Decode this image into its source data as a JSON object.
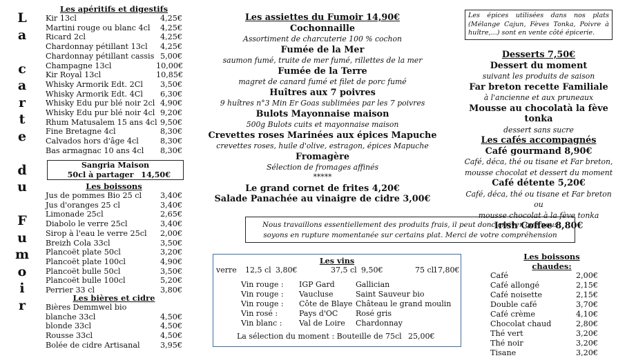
{
  "side_title": [
    "L",
    "a",
    "",
    "c",
    "a",
    "r",
    "t",
    "e",
    "",
    "d",
    "u",
    "",
    "F",
    "u",
    "m",
    "o",
    "i",
    "r"
  ],
  "aperitifs": {
    "title": "Les apéritifs et digestifs",
    "items": [
      {
        "name": "Kir 13cl",
        "price": "4,25€"
      },
      {
        "name": "Martini rouge ou blanc 4cl",
        "price": "4,25€"
      },
      {
        "name": "Ricard 2cl",
        "price": "4,25€"
      },
      {
        "name": "Chardonnay pétillant   13cl",
        "price": "4,25€"
      },
      {
        "name": "Chardonnay pétillant cassis",
        "price": "5,00€"
      },
      {
        "name": "Champagne 13cl",
        "price": "10,00€"
      },
      {
        "name": "Kir Royal 13cl",
        "price": "10,85€"
      },
      {
        "name": "Whisky Armorik Edt. 2Cl",
        "price": "3,50€"
      },
      {
        "name": "Whisky Armorik Edt. 4Cl",
        "price": "6,30€"
      },
      {
        "name": "Whisky Edu pur blé noir 2cl",
        "price": "4,90€"
      },
      {
        "name": "Whisky Edu pur blé noir 4cl",
        "price": "9,20€"
      },
      {
        "name": "Rhum Matusalem 15 ans 4cl",
        "price": "9,50€"
      },
      {
        "name": "Fine Bretagne 4cl",
        "price": "8,30€"
      },
      {
        "name": "Calvados hors d'âge 4cl",
        "price": "8,30€"
      },
      {
        "name": "Bas armagnac 10 ans 4cl",
        "price": "8,30€"
      }
    ]
  },
  "sangria": {
    "title": "Sangria Maison",
    "label": "50cl à partager",
    "price": "14,50€"
  },
  "boissons": {
    "title": "Les boissons",
    "items": [
      {
        "name": "Jus de pommes Bio 25 cl",
        "price": "3,40€"
      },
      {
        "name": "Jus d'oranges 25 cl",
        "price": "3,40€"
      },
      {
        "name": "Limonade 25cl",
        "price": "2,65€"
      },
      {
        "name": "Diabolo le verre 25cl",
        "price": "3,40€"
      },
      {
        "name": "Sirop à l'eau le verre 25cl",
        "price": "2,00€"
      },
      {
        "name": "Breizh Cola 33cl",
        "price": "3,50€"
      },
      {
        "name": "Plancoët plate 50cl",
        "price": "3,20€"
      },
      {
        "name": "Plancoët plate 100cl",
        "price": "4,90€"
      },
      {
        "name": "Plancoët bulle 50cl",
        "price": "3,50€"
      },
      {
        "name": "Plancoët bulle 100cl",
        "price": "5,20€"
      },
      {
        "name": "Perrier 33 cl",
        "price": "3,80€"
      }
    ]
  },
  "bieres": {
    "title": "Les bières et cidre",
    "intro": "Bières Demmwel bio",
    "items": [
      {
        "name": "blanche 33cl",
        "price": "4,50€"
      },
      {
        "name": "blonde 33cl",
        "price": "4,50€"
      },
      {
        "name": "Rousse 33cl",
        "price": "4,50€"
      },
      {
        "name": "Bolée de cidre Artisanal",
        "price": "3,95€"
      }
    ]
  },
  "assiettes": {
    "title": "Les assiettes du Fumoir 14,90€",
    "items": [
      {
        "name": "Cochonnaille",
        "desc": "Assortiment de charcuterie 100 % cochon"
      },
      {
        "name": "Fumée de la Mer",
        "desc": "saumon fumé, truite de mer fumé, rillettes de la mer"
      },
      {
        "name": "Fumée de la Terre",
        "desc": "magret de canard fumé et filet de porc fumé"
      },
      {
        "name": "Huîtres aux 7 poivres",
        "desc": "9 huîtres n°3 Min Er Goas sublimées par les 7 poivres"
      },
      {
        "name": "Bulots Mayonnaise maison",
        "desc": "500g Bulots cuits et mayonnaise maison"
      },
      {
        "name": "Crevettes roses Marinées aux épices Mapuche",
        "desc": "crevettes roses, huile d'olive, estragon, épices Mapuche"
      },
      {
        "name": "Fromagère",
        "desc": "Sélection de fromages affinés"
      }
    ],
    "stars": "*****",
    "extra1": "Le grand cornet de frites 4,20€",
    "extra2": "Salade Panachée au vinaigre de cidre 3,00€"
  },
  "epices_note": "Les épices utilisées dans nos plats (Mélange Cajun, Fèves Tonka, Poivre à huître,...) sont en vente côté épicerie.",
  "desserts": {
    "title": "Desserts 7,50€",
    "items": [
      {
        "name": "Dessert du moment",
        "desc": "suivant les produits de saison"
      },
      {
        "name": "Far breton recette Familiale",
        "desc": "à l'ancienne et aux pruneaux"
      },
      {
        "name": "Mousse au chocolatà la fève tonka",
        "desc": "dessert sans sucre"
      }
    ]
  },
  "cafes": {
    "title": "Les cafés accompagnés",
    "items": [
      {
        "name": "Café gourmand 8,90€",
        "desc": [
          "Café, déca, thé ou tisane et Far breton,",
          "mousse chocolat et dessert du moment"
        ]
      },
      {
        "name": "Café détente 5,20€",
        "desc": [
          "Café, déca, thé ou tisane et Far breton ou",
          "mousse chocolat à la fève tonka"
        ]
      },
      {
        "name": "Irish Coffee 8,80€",
        "desc": []
      }
    ]
  },
  "produits_note": [
    "Nous travaillons essentiellement des produits frais, il peut donc arriver que nous",
    "soyons en rupture momentanée sur certains plat. Merci de votre compréhension"
  ],
  "vins": {
    "title": "Les vins",
    "sizes": {
      "verre": "verre",
      "s1": "12,5 cl",
      "p1": "3,80€",
      "s2": "37,5 cl",
      "p2": "9,50€",
      "s3": "75 cl",
      "p3": "17,80€"
    },
    "rows": [
      {
        "type": "Vin rouge :",
        "a": "IGP Gard",
        "b": "Gallician"
      },
      {
        "type": "Vin rouge :",
        "a": "Vaucluse",
        "b": "Saint Sauveur bio"
      },
      {
        "type": "Vin rouge :",
        "a": "Côte de Blaye",
        "b": "Château le grand moulin"
      },
      {
        "type": "Vin rosé :",
        "a": "Pays d'OC",
        "b": "Rosé gris"
      },
      {
        "type": "Vin blanc :",
        "a": "Val de Loire",
        "b": "Chardonnay"
      }
    ],
    "moment": "La sélection du moment : Bouteille de 75cl",
    "moment_price": "25,00€"
  },
  "chaudes": {
    "title": "Les boissons chaudes:",
    "items": [
      {
        "name": "Café",
        "price": "2,00€"
      },
      {
        "name": "Café allongé",
        "price": "2,15€"
      },
      {
        "name": "Café noisette",
        "price": "2,15€"
      },
      {
        "name": "Double café",
        "price": "3,70€"
      },
      {
        "name": "Café crème",
        "price": "4,10€"
      },
      {
        "name": "Chocolat chaud",
        "price": "2,80€"
      },
      {
        "name": "Thé vert",
        "price": "3,20€"
      },
      {
        "name": "Thé noir",
        "price": "3,20€"
      },
      {
        "name": "Tisane",
        "price": "3,20€"
      }
    ]
  }
}
